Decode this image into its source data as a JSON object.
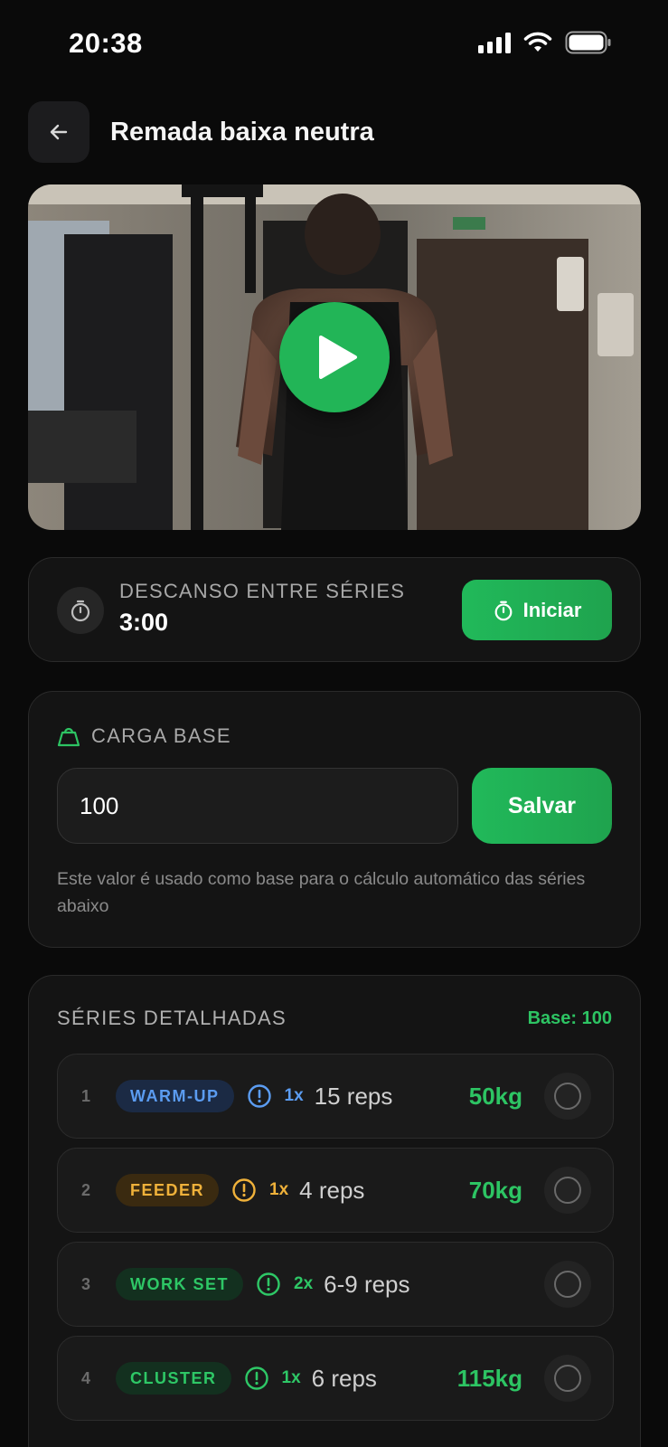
{
  "status_bar": {
    "time": "20:38"
  },
  "header": {
    "title": "Remada baixa neutra"
  },
  "rest": {
    "label": "DESCANSO ENTRE SÉRIES",
    "value": "3:00",
    "button_label": "Iniciar"
  },
  "load": {
    "label": "CARGA BASE",
    "input_value": "100",
    "save_label": "Salvar",
    "hint": "Este valor é usado como base para o cálculo automático das séries abaixo"
  },
  "series": {
    "title": "SÉRIES DETALHADAS",
    "base": "Base: 100",
    "rows": [
      {
        "num": "1",
        "tag": "WARM-UP",
        "mult": "1x",
        "reps": "15 reps",
        "weight": "50kg"
      },
      {
        "num": "2",
        "tag": "FEEDER",
        "mult": "1x",
        "reps": "4 reps",
        "weight": "70kg"
      },
      {
        "num": "3",
        "tag": "WORK SET",
        "mult": "2x",
        "reps": "6-9 reps",
        "weight": ""
      },
      {
        "num": "4",
        "tag": "CLUSTER",
        "mult": "1x",
        "reps": "6 reps",
        "weight": "115kg"
      }
    ]
  },
  "colors": {
    "accent": "#22b557",
    "warmup": "#5b9cf1",
    "feeder": "#efb13a",
    "workset": "#2ec766",
    "background": "#0a0a0a"
  }
}
